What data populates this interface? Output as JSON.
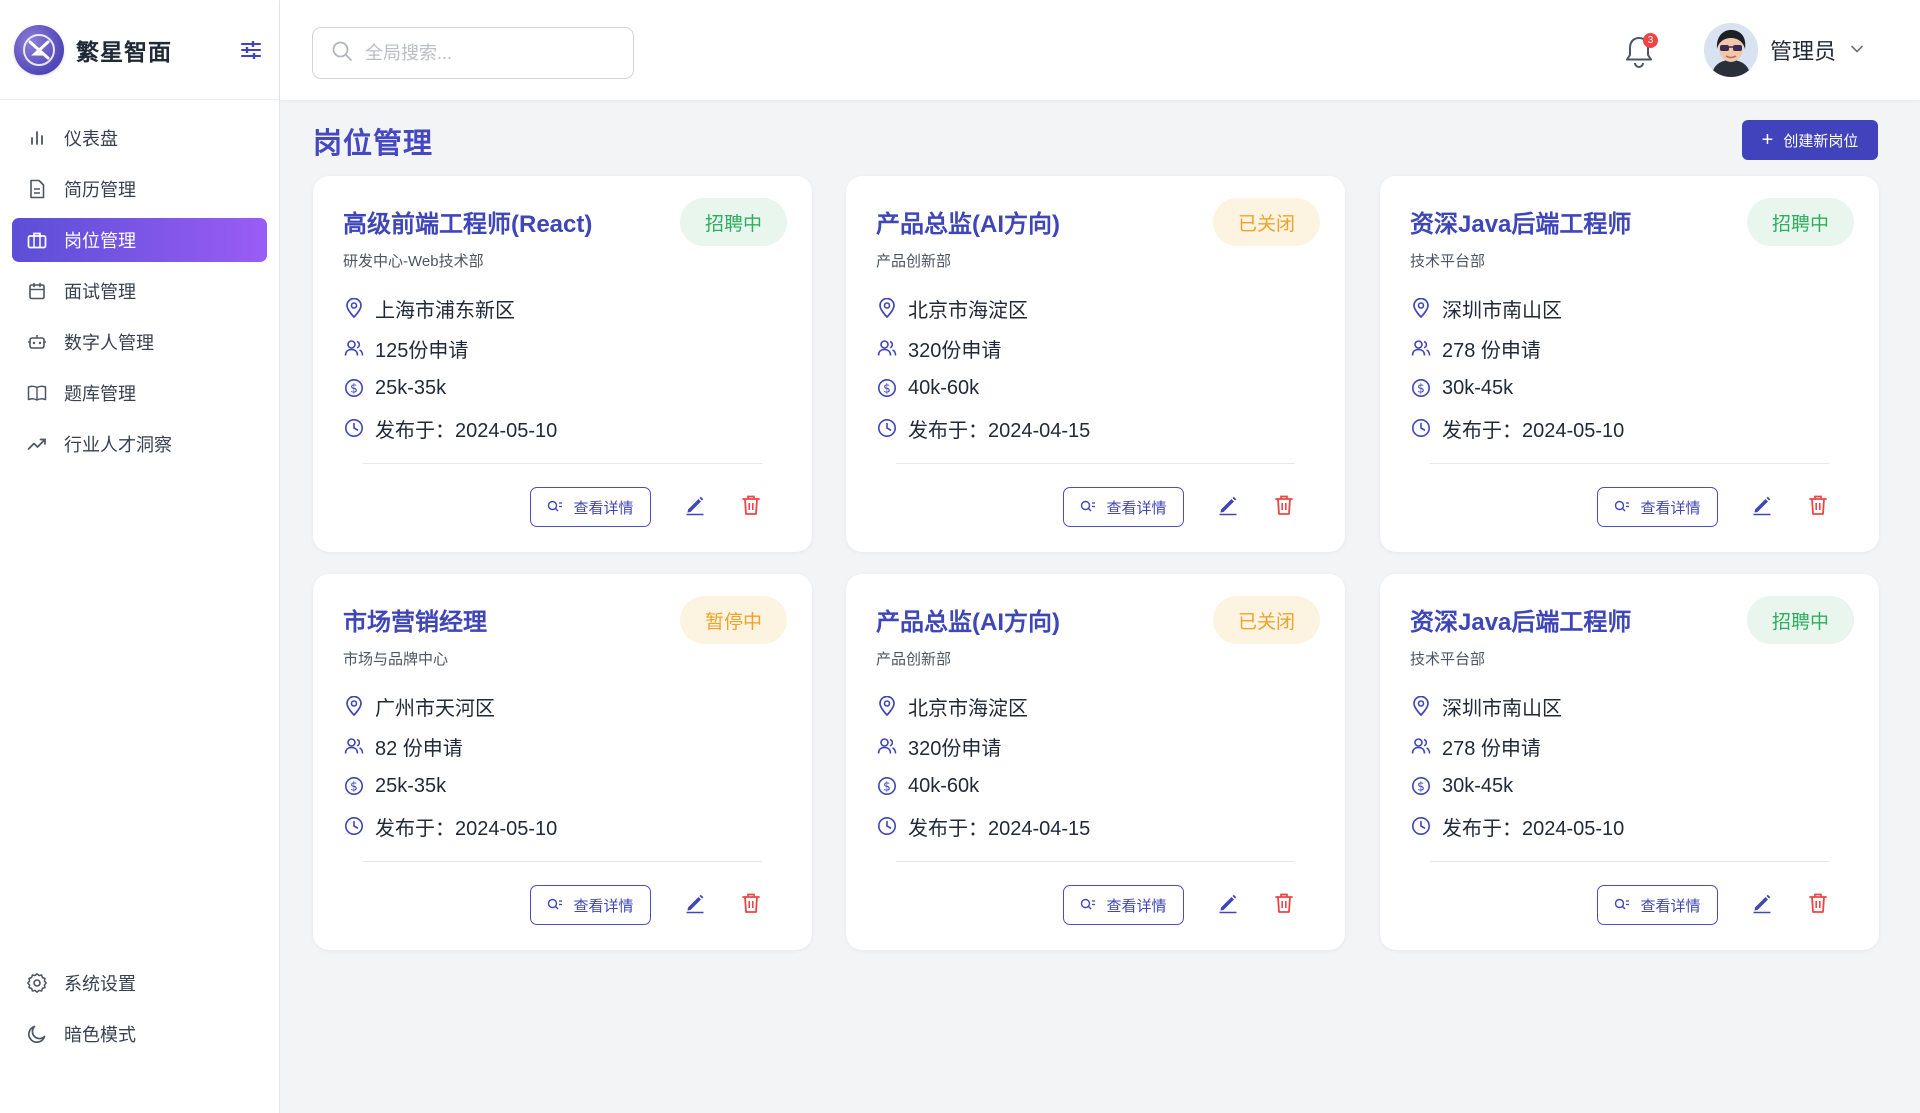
{
  "app": {
    "name": "繁星智面"
  },
  "sidebar": {
    "items": [
      {
        "label": "仪表盘",
        "icon": "bar-chart-icon",
        "active": false
      },
      {
        "label": "简历管理",
        "icon": "document-icon",
        "active": false
      },
      {
        "label": "岗位管理",
        "icon": "briefcase-icon",
        "active": true
      },
      {
        "label": "面试管理",
        "icon": "calendar-icon",
        "active": false
      },
      {
        "label": "数字人管理",
        "icon": "robot-icon",
        "active": false
      },
      {
        "label": "题库管理",
        "icon": "book-icon",
        "active": false
      },
      {
        "label": "行业人才洞察",
        "icon": "trend-icon",
        "active": false
      }
    ],
    "bottom": [
      {
        "label": "系统设置",
        "icon": "gear-icon"
      },
      {
        "label": "暗色模式",
        "icon": "moon-icon"
      }
    ]
  },
  "header": {
    "search_placeholder": "全局搜索...",
    "notification_count": "3",
    "user_name": "管理员"
  },
  "main": {
    "title": "岗位管理",
    "create_label": "创建新岗位",
    "detail_label": "查看详情",
    "jobs": [
      {
        "title": "高级前端工程师(React)",
        "dept": "研发中心-Web技术部",
        "status": "招聘中",
        "status_color": "green",
        "location": "上海市浦东新区",
        "applications": "125份申请",
        "salary": "25k-35k",
        "published": "发布于：2024-05-10"
      },
      {
        "title": "产品总监(AI方向)",
        "dept": "产品创新部",
        "status": "已关闭",
        "status_color": "orange",
        "location": "北京市海淀区",
        "applications": "320份申请",
        "salary": "40k-60k",
        "published": "发布于：2024-04-15"
      },
      {
        "title": "资深Java后端工程师",
        "dept": "技术平台部",
        "status": "招聘中",
        "status_color": "green",
        "location": "深圳市南山区",
        "applications": "278 份申请",
        "salary": "30k-45k",
        "published": "发布于：2024-05-10"
      },
      {
        "title": "市场营销经理",
        "dept": "市场与品牌中心",
        "status": "暂停中",
        "status_color": "orange",
        "location": "广州市天河区",
        "applications": "82 份申请",
        "salary": "25k-35k",
        "published": "发布于：2024-05-10"
      },
      {
        "title": "产品总监(AI方向)",
        "dept": "产品创新部",
        "status": "已关闭",
        "status_color": "orange",
        "location": "北京市海淀区",
        "applications": "320份申请",
        "salary": "40k-60k",
        "published": "发布于：2024-04-15"
      },
      {
        "title": "资深Java后端工程师",
        "dept": "技术平台部",
        "status": "招聘中",
        "status_color": "green",
        "location": "深圳市南山区",
        "applications": "278 份申请",
        "salary": "30k-45k",
        "published": "发布于：2024-05-10"
      }
    ]
  },
  "colors": {
    "accent": "#4043bb",
    "active_gradient_start": "#5a4fd6",
    "active_gradient_end": "#9b5cf6",
    "status_green": "#2fae5f",
    "status_orange": "#f0a32b",
    "delete_red": "#ef4444"
  }
}
